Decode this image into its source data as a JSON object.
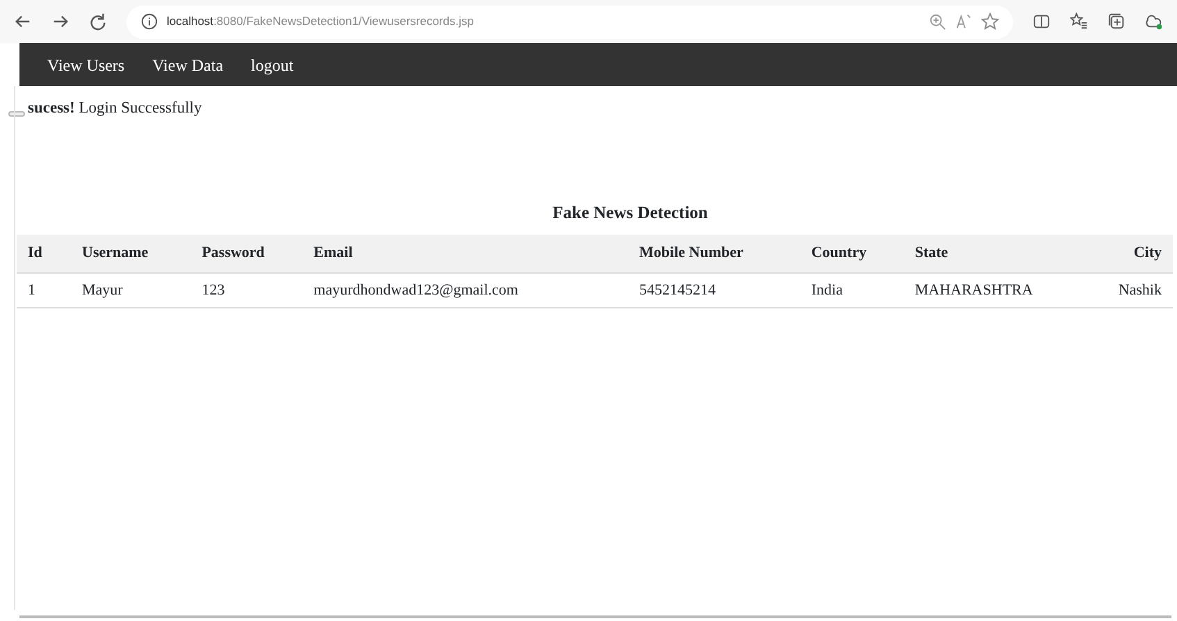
{
  "browser": {
    "url_host": "localhost",
    "url_rest": ":8080/FakeNewsDetection1/Viewusersrecords.jsp"
  },
  "nav": {
    "items": [
      "View Users",
      "View Data",
      "logout"
    ]
  },
  "alert": {
    "text": "**sucess!** Login Successfully"
  },
  "title": "Fake News Detection",
  "table": {
    "columns": [
      "Id",
      "Username",
      "Password",
      "Email",
      "Mobile Number",
      "Country",
      "State",
      "City"
    ],
    "rows": [
      [
        "1",
        "Mayur",
        "123",
        "mayurdhondwad123@gmail.com",
        "5452145214",
        "India",
        "MAHARASHTRA",
        "Nashik"
      ]
    ]
  }
}
